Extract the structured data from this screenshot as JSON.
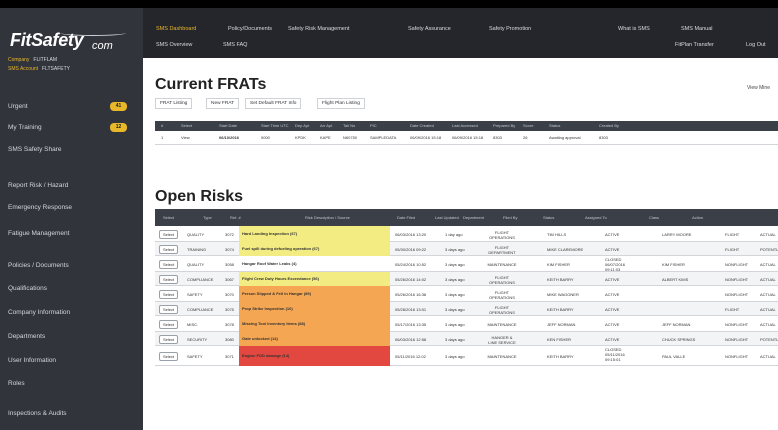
{
  "brand": {
    "name": "FitSafety",
    "suffix": "com"
  },
  "context": {
    "company_label": "Company",
    "company_value": "FLITFLAM",
    "account_label": "SMS Account",
    "account_value": "FLTSAFETY"
  },
  "sidebar": {
    "items": [
      {
        "label": "Urgent",
        "badge": "41"
      },
      {
        "label": "My Training",
        "badge": "12"
      },
      {
        "label": "SMS Safety Share"
      },
      {
        "label": "Report Risk / Hazard"
      },
      {
        "label": "Emergency Response"
      },
      {
        "label": "Fatigue Management"
      },
      {
        "label": "Policies / Documents"
      },
      {
        "label": "Qualifications"
      },
      {
        "label": "Company Information"
      },
      {
        "label": "Departments"
      },
      {
        "label": "User Information"
      },
      {
        "label": "Roles"
      },
      {
        "label": "Inspections & Audits"
      }
    ]
  },
  "nav": {
    "primary": [
      "SMS Dashboard",
      "Policy/Documents",
      "Safety Risk Management",
      "Safety Assurance",
      "Safety Promotion",
      "What is SMS",
      "SMS Manual"
    ],
    "secondary": [
      "SMS Overview",
      "SMS FAQ",
      "FitPlan Transfer",
      "Log Out"
    ]
  },
  "frats": {
    "title": "Current FRATs",
    "view_my": "View Mine",
    "tabs": [
      "FRAT Listing",
      "New FRAT",
      "Set Default FRAT Info",
      "Flight Plan Listing"
    ],
    "columns": [
      "#",
      "Select",
      "Start Date",
      "Start Time UTC",
      "Dep Apt",
      "Arr Apt",
      "Tail No",
      "PIC",
      "Date Created",
      "Last Accessed",
      "Prepared By",
      "Score",
      "Status",
      "Created By"
    ],
    "rows": [
      {
        "num": "1",
        "select": "View",
        "date": "06/10/2016",
        "time": "0000",
        "dep": "KPDK",
        "arr": "KAPE",
        "tail": "N60750",
        "pic": "SAMPLEDATA",
        "created": "06/09/2016 15:18",
        "accessed": "06/09/2016 15:18",
        "prepared": "8303",
        "score": "26",
        "status": "Awaiting approval",
        "by": "8303"
      }
    ]
  },
  "risks": {
    "title": "Open Risks",
    "columns": [
      "",
      "Select",
      "Type",
      "Ref. #",
      "Risk Description / Source",
      "Date Filed",
      "Last Updated",
      "Department",
      "Filed By",
      "Status",
      "Assigned To",
      "Class",
      "Action"
    ],
    "rows": [
      {
        "select": "Select",
        "type": "QUALITY",
        "ref": "3072",
        "desc": "Hard Landing Inspection (67)",
        "filed": "06/03/2016 13:20",
        "updated": "1 day ago",
        "dept": [
          "FLIGHT",
          "OPERATIONS"
        ],
        "by": "TIM HILLS",
        "status": [
          "ACTIVE"
        ],
        "assigned": "LARRY MOORE",
        "cls": "FLIGHT",
        "action": "ACTUAL",
        "color": "#f3ec82"
      },
      {
        "select": "Select",
        "type": "TRAINING",
        "ref": "3074",
        "desc": "Fuel spill during defueling operation (67)",
        "filed": "05/30/2016 09:22",
        "updated": "3 days ago",
        "dept": [
          "FLIGHT",
          "DEPARTMENT"
        ],
        "by": "MIKE CLAREMORE",
        "status": [
          "ACTIVE"
        ],
        "assigned": "",
        "cls": "FLIGHT",
        "action": "POTENTIAL",
        "color": "#f3ec82"
      },
      {
        "select": "Select",
        "type": "QUALITY",
        "ref": "3058",
        "desc": "Hangar Roof Water Leaks (4)",
        "filed": "05/24/2016 10:52",
        "updated": "3 days ago",
        "dept": [
          "MAINTENANCE"
        ],
        "by": "KIM FISHER",
        "status": [
          "CLOSED",
          "06/07/2016",
          "09:11:03"
        ],
        "assigned": "KIM FISHER",
        "cls": "NONFLIGHT",
        "action": "ACTUAL",
        "color": ""
      },
      {
        "select": "Select",
        "type": "COMPLIANCE",
        "ref": "3067",
        "desc": "Flight Crew Duty Hours Exceedance (56)",
        "filed": "05/26/2016 14:02",
        "updated": "3 days ago",
        "dept": [
          "FLIGHT",
          "OPERATIONS"
        ],
        "by": "KEITH BARRY",
        "status": [
          "ACTIVE"
        ],
        "assigned": "ALBERT KIMS",
        "cls": "NONFLIGHT",
        "action": "ACTUAL",
        "color": "#f3ec82"
      },
      {
        "select": "Select",
        "type": "SAFETY",
        "ref": "3070",
        "desc": "Person Slipped & Fell in Hangar (89)",
        "filed": "05/26/2016 16:38",
        "updated": "3 days ago",
        "dept": [
          "FLIGHT",
          "OPERATIONS"
        ],
        "by": "MIKE WAGONER",
        "status": [
          "ACTIVE"
        ],
        "assigned": "",
        "cls": "NONFLIGHT",
        "action": "ACTUAL",
        "color": "#f4a653"
      },
      {
        "select": "Select",
        "type": "COMPLIANCE",
        "ref": "3075",
        "desc": "Prop Strike Inspection (10)",
        "filed": "05/28/2016 13:01",
        "updated": "3 days ago",
        "dept": [
          "FLIGHT",
          "OPERATIONS"
        ],
        "by": "KEITH BARRY",
        "status": [
          "ACTIVE"
        ],
        "assigned": "",
        "cls": "FLIGHT",
        "action": "ACTUAL",
        "color": "#f4a653"
      },
      {
        "select": "Select",
        "type": "MISC.",
        "ref": "3078",
        "desc": "Missing Tool Inventory Items (88)",
        "filed": "05/17/2016 13:35",
        "updated": "3 days ago",
        "dept": [
          "MAINTENANCE"
        ],
        "by": "JEFF NORMAN",
        "status": [
          "ACTIVE"
        ],
        "assigned": "JEFF NORMAN",
        "cls": "NONFLIGHT",
        "action": "ACTUAL",
        "color": "#f4a653"
      },
      {
        "select": "Select",
        "type": "SECURITY",
        "ref": "3080",
        "desc": "Gate unlocked (14)",
        "filed": "06/03/2016 12:58",
        "updated": "3 days ago",
        "dept": [
          "HANGER &",
          "LINE SERVICE"
        ],
        "by": "KEN FISHER",
        "status": [
          "ACTIVE"
        ],
        "assigned": "CHUCK SPRINGS",
        "cls": "NONFLIGHT",
        "action": "POTENTIAL",
        "color": "#f4a653"
      },
      {
        "select": "Select",
        "type": "SAFETY",
        "ref": "3071",
        "desc": "Engine FOD damage (14)",
        "filed": "05/11/2016 12:02",
        "updated": "3 days ago",
        "dept": [
          "MAINTENANCE"
        ],
        "by": "KEITH BARRY",
        "status": [
          "CLOSED",
          "05/11/2016",
          "09:15:01"
        ],
        "assigned": "PAUL VALLE",
        "cls": "NONFLIGHT",
        "action": "ACTUAL",
        "color": "#e2483f"
      }
    ]
  }
}
